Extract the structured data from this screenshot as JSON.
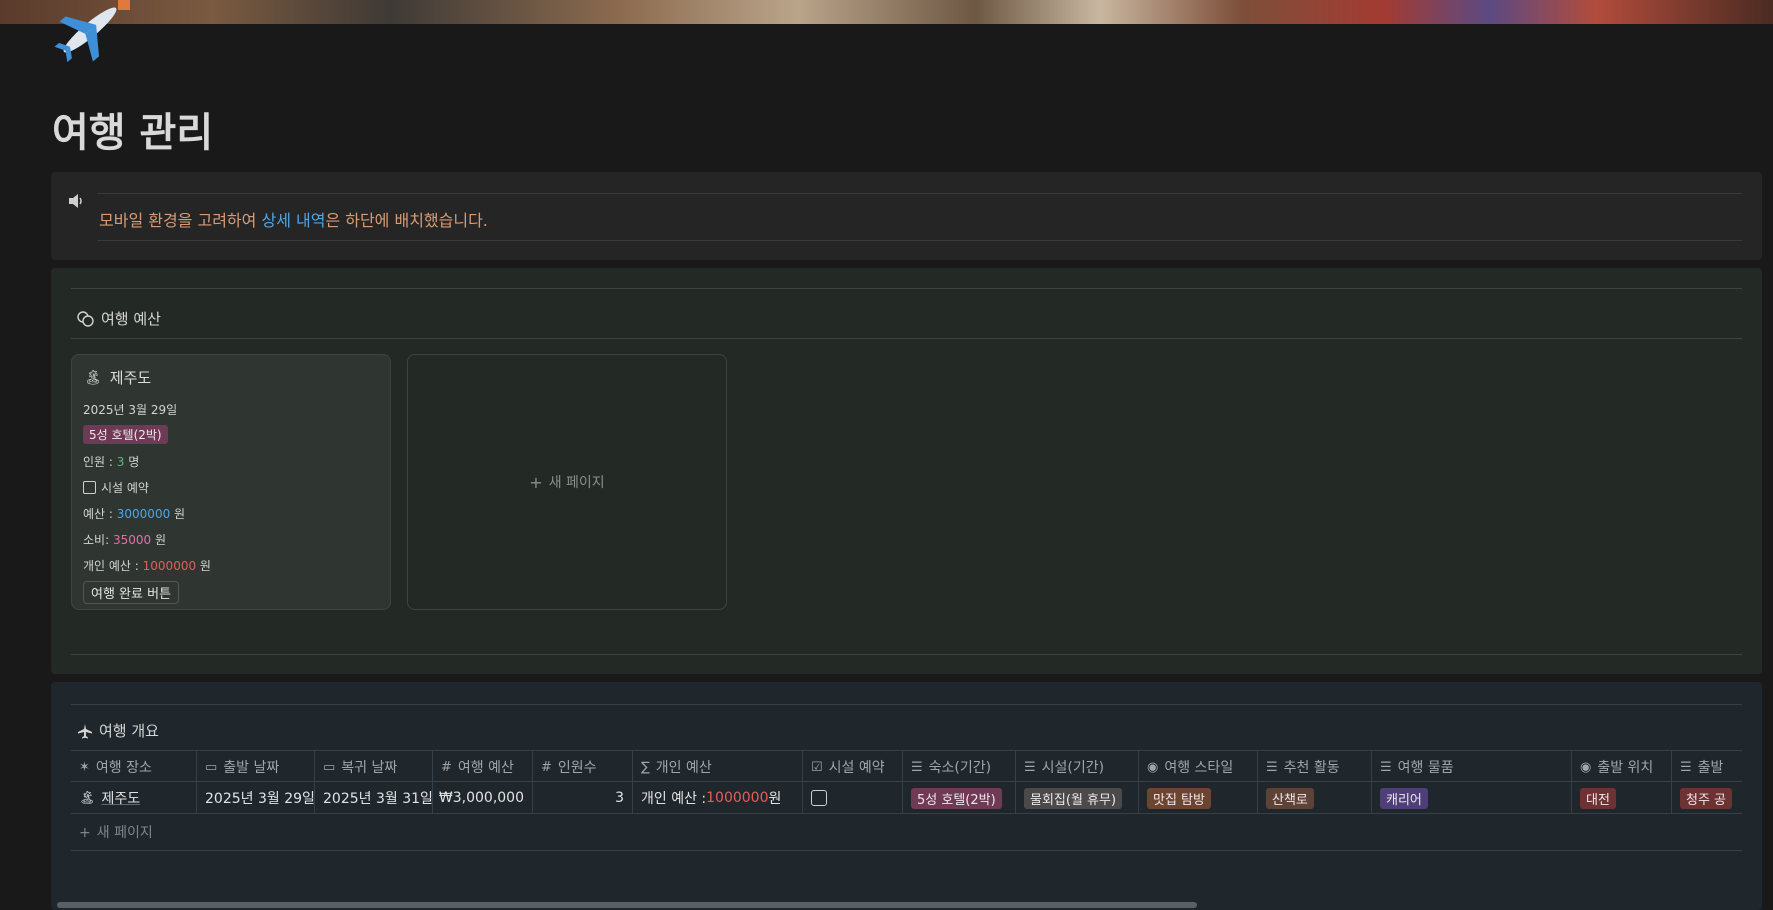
{
  "page": {
    "title": "여행 관리",
    "icon": "airplane-icon"
  },
  "callout": {
    "icon": "speaker-icon",
    "text_pre": "모바일 환경을 고려하여 ",
    "text_link": "상세 내역",
    "text_post": "은 하단에 배치했습니다."
  },
  "budget_section": {
    "icon": "coins-icon",
    "title": "여행 예산",
    "card": {
      "icon": "island-icon",
      "title": "제주도",
      "date": "2025년 3월 29일",
      "lodging_tag": "5성 호텔(2박)",
      "people_label": "인원 : ",
      "people_value": "3",
      "people_unit": " 명",
      "facility_label": "시설 예약",
      "budget_label": "예산 : ",
      "budget_value": "3000000",
      "budget_unit": " 원",
      "spend_label": "소비: ",
      "spend_value": "35000",
      "spend_unit": " 원",
      "personal_label": "개인 예산 : ",
      "personal_value": "1000000",
      "personal_unit": " 원",
      "done_button": "여행 완료 버튼"
    },
    "new_page": "새 페이지"
  },
  "overview_section": {
    "icon": "airplane-small-icon",
    "title": "여행 개요",
    "columns": [
      {
        "icon": "✶",
        "label": "여행 장소"
      },
      {
        "icon": "▭",
        "label": "출발 날짜"
      },
      {
        "icon": "▭",
        "label": "복귀 날짜"
      },
      {
        "icon": "#",
        "label": "여행 예산"
      },
      {
        "icon": "#",
        "label": "인원수"
      },
      {
        "icon": "∑",
        "label": "개인 예산"
      },
      {
        "icon": "☑",
        "label": "시설 예약"
      },
      {
        "icon": "☰",
        "label": "숙소(기간)"
      },
      {
        "icon": "☰",
        "label": "시설(기간)"
      },
      {
        "icon": "◉",
        "label": "여행 스타일"
      },
      {
        "icon": "☰",
        "label": "추천 활동"
      },
      {
        "icon": "☰",
        "label": "여행 물품"
      },
      {
        "icon": "◉",
        "label": "출발 위치"
      },
      {
        "icon": "☰",
        "label": "출발"
      }
    ],
    "row": {
      "place_icon": "island-icon",
      "place": "제주도",
      "depart_date": "2025년 3월 29일",
      "return_date": "2025년 3월 31일",
      "budget": "₩3,000,000",
      "people": "3",
      "personal_label": "개인 예산 : ",
      "personal_value": "1000000",
      "personal_unit": " 원",
      "lodging": "5성 호텔(2박)",
      "facility": "물회집(월 휴무)",
      "style": "맛집 탐방",
      "activity": "산책로",
      "items": "캐리어",
      "depart_loc": "대전",
      "depart_extra": "청주 공"
    },
    "new_page": "새 페이지"
  },
  "colors": {
    "background": "#191919",
    "callout_text": "#d89b75",
    "link": "#4ea6e6",
    "budget_bg": "#232925",
    "overview_bg": "#1f272d"
  }
}
